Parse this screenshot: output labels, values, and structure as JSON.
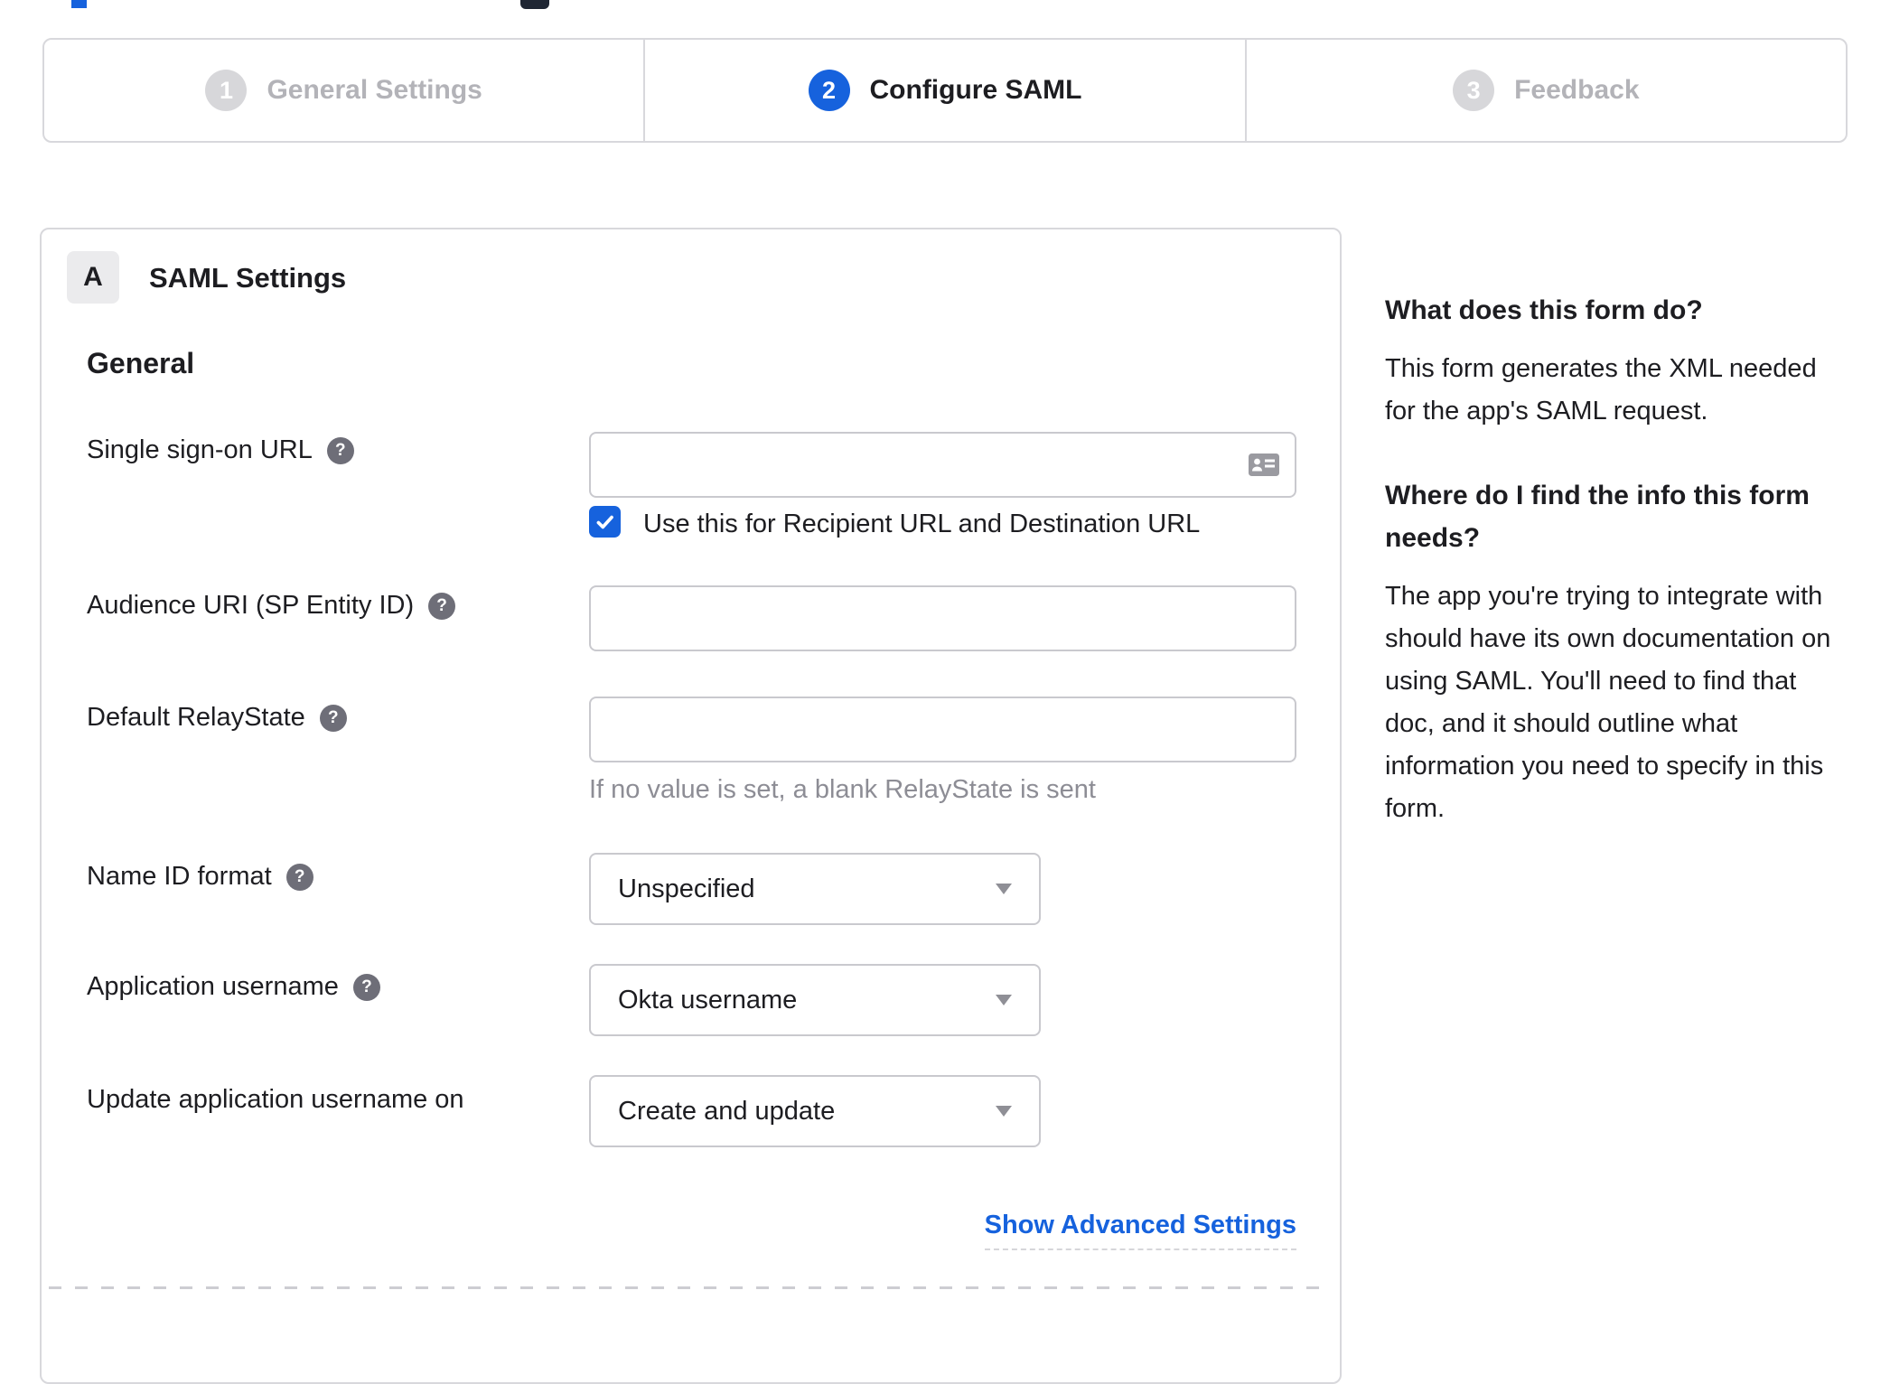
{
  "colors": {
    "accent_blue": "#1662dd",
    "inactive_gray": "#d7d7da",
    "text_dark": "#1d1d21",
    "muted_gray": "#8d8d95",
    "border_gray": "#d8d8dc"
  },
  "stepper": {
    "steps": [
      {
        "number": "1",
        "label": "General Settings",
        "active": false
      },
      {
        "number": "2",
        "label": "Configure SAML",
        "active": true
      },
      {
        "number": "3",
        "label": "Feedback",
        "active": false
      }
    ]
  },
  "panel": {
    "badge": "A",
    "title": "SAML Settings",
    "section_heading": "General",
    "fields": {
      "sso": {
        "label": "Single sign-on URL",
        "value": "",
        "checkbox_label": "Use this for Recipient URL and Destination URL",
        "checkbox_checked": true
      },
      "audience": {
        "label": "Audience URI (SP Entity ID)",
        "value": ""
      },
      "relay_state": {
        "label": "Default RelayState",
        "value": "",
        "hint": "If no value is set, a blank RelayState is sent"
      },
      "name_id_format": {
        "label": "Name ID format",
        "value": "Unspecified"
      },
      "app_username": {
        "label": "Application username",
        "value": "Okta username"
      },
      "update_app_username": {
        "label": "Update application username on",
        "value": "Create and update"
      }
    },
    "advanced_link": "Show Advanced Settings"
  },
  "sidebar": {
    "q1": "What does this form do?",
    "a1": "This form generates the XML needed for the app's SAML request.",
    "q2": "Where do I find the info this form needs?",
    "a2": "The app you're trying to integrate with should have its own documentation on using SAML. You'll need to find that doc, and it should outline what information you need to specify in this form."
  }
}
